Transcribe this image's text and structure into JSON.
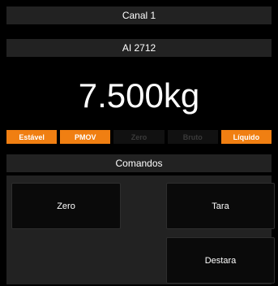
{
  "header": {
    "title": "Canal 1"
  },
  "device": {
    "name": "AI 2712"
  },
  "display": {
    "weight": "7.500kg"
  },
  "status": [
    {
      "label": "Estável",
      "active": true
    },
    {
      "label": "PMOV",
      "active": true
    },
    {
      "label": "Zero",
      "active": false
    },
    {
      "label": "Bruto",
      "active": false
    },
    {
      "label": "Líquido",
      "active": true
    }
  ],
  "commands": {
    "title": "Comandos",
    "zero_label": "Zero",
    "tara_label": "Tara",
    "destara_label": "Destara"
  },
  "colors": {
    "accent": "#f07f12",
    "panel": "#222222",
    "background": "#000000"
  }
}
